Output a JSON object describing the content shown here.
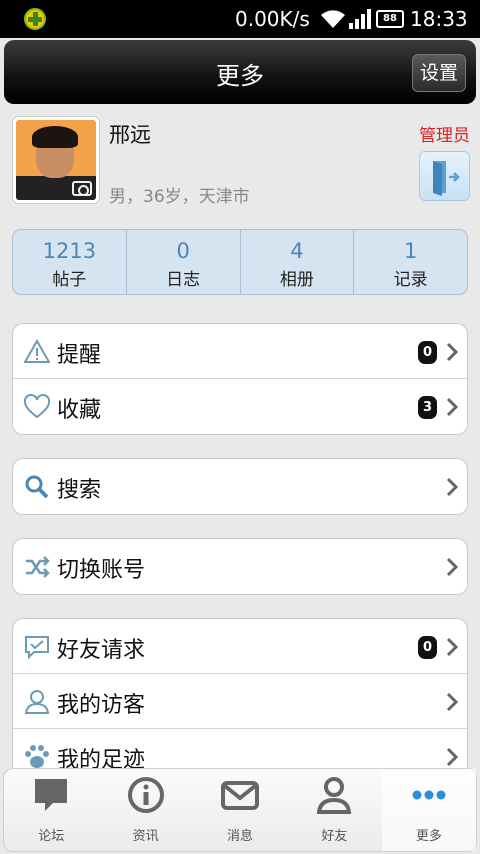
{
  "status_bar": {
    "speed": "0.00K/s",
    "battery": "88",
    "time": "18:33"
  },
  "header": {
    "title": "更多",
    "settings_label": "设置"
  },
  "profile": {
    "name": "邢远",
    "info": "男，36岁，天津市",
    "role": "管理员"
  },
  "stats": [
    {
      "value": "1213",
      "label": "帖子"
    },
    {
      "value": "0",
      "label": "日志"
    },
    {
      "value": "4",
      "label": "相册"
    },
    {
      "value": "1",
      "label": "记录"
    }
  ],
  "menu": {
    "alerts": {
      "label": "提醒",
      "badge": "0"
    },
    "favorites": {
      "label": "收藏",
      "badge": "3"
    },
    "search": {
      "label": "搜索"
    },
    "switch_account": {
      "label": "切换账号"
    },
    "friend_requests": {
      "label": "好友请求",
      "badge": "0"
    },
    "visitors": {
      "label": "我的访客"
    },
    "footprints": {
      "label": "我的足迹"
    }
  },
  "tabs": [
    {
      "label": "论坛",
      "icon": "speech-bubble-icon"
    },
    {
      "label": "资讯",
      "icon": "info-icon"
    },
    {
      "label": "消息",
      "icon": "envelope-icon"
    },
    {
      "label": "好友",
      "icon": "person-icon"
    },
    {
      "label": "更多",
      "icon": "more-dots-icon",
      "active": true
    }
  ],
  "colors": {
    "accent": "#4a86b8",
    "role": "#e02020",
    "active_tab": "#2a8fd8"
  }
}
